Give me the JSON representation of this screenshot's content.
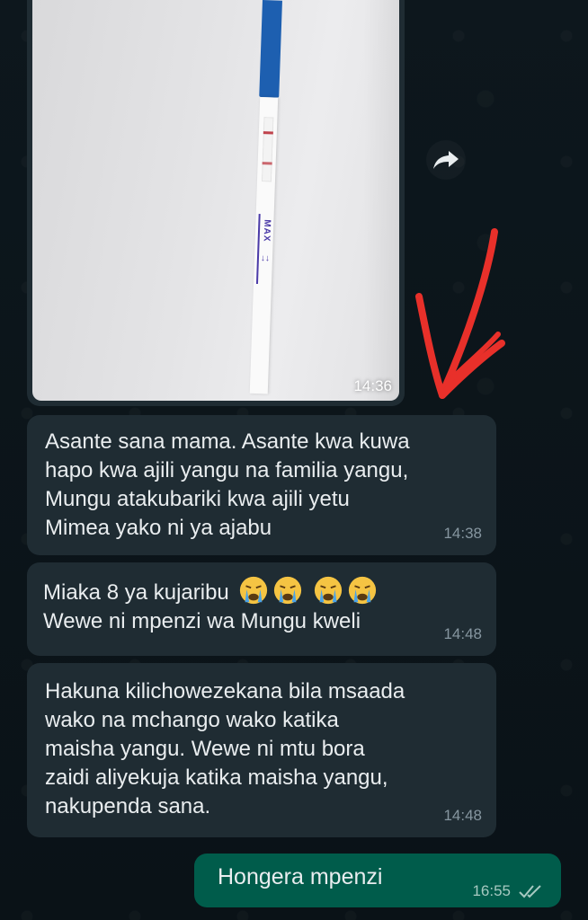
{
  "chat": {
    "messages": [
      {
        "type": "image",
        "time": "14:36",
        "test_strip_label": "MAX"
      },
      {
        "type": "text",
        "direction": "incoming",
        "text": "Asante sana mama. Asante kwa kuwa\nhapo kwa ajili yangu na familia yangu,\nMungu atakubariki kwa ajili yetu\nMimea yako ni ya ajabu",
        "time": "14:38"
      },
      {
        "type": "text",
        "direction": "incoming",
        "line1": "Miaka 8 ya kujaribu",
        "line2": "Wewe ni mpenzi wa Mungu kweli",
        "emoji": [
          "crying-face",
          "crying-face",
          "crying-face",
          "crying-face"
        ],
        "time": "14:48"
      },
      {
        "type": "text",
        "direction": "incoming",
        "text": "Hakuna kilichowezekana bila msaada\nwako na mchango wako katika\nmaisha yangu. Wewe ni mtu bora\nzaidi aliyekuja katika maisha yangu,\nnakupenda sana.",
        "time": "14:48"
      },
      {
        "type": "text",
        "direction": "outgoing",
        "text": "Hongera mpenzi",
        "time": "16:55",
        "status_icon": "double-check-icon"
      }
    ]
  },
  "icons": {
    "forward": "forward-icon",
    "annotation": "red-arrow-annotation"
  },
  "colors": {
    "background": "#0b141a",
    "incoming_bubble": "#1f2c33",
    "outgoing_bubble": "#005c4b",
    "annotation_red": "#e8302a"
  }
}
